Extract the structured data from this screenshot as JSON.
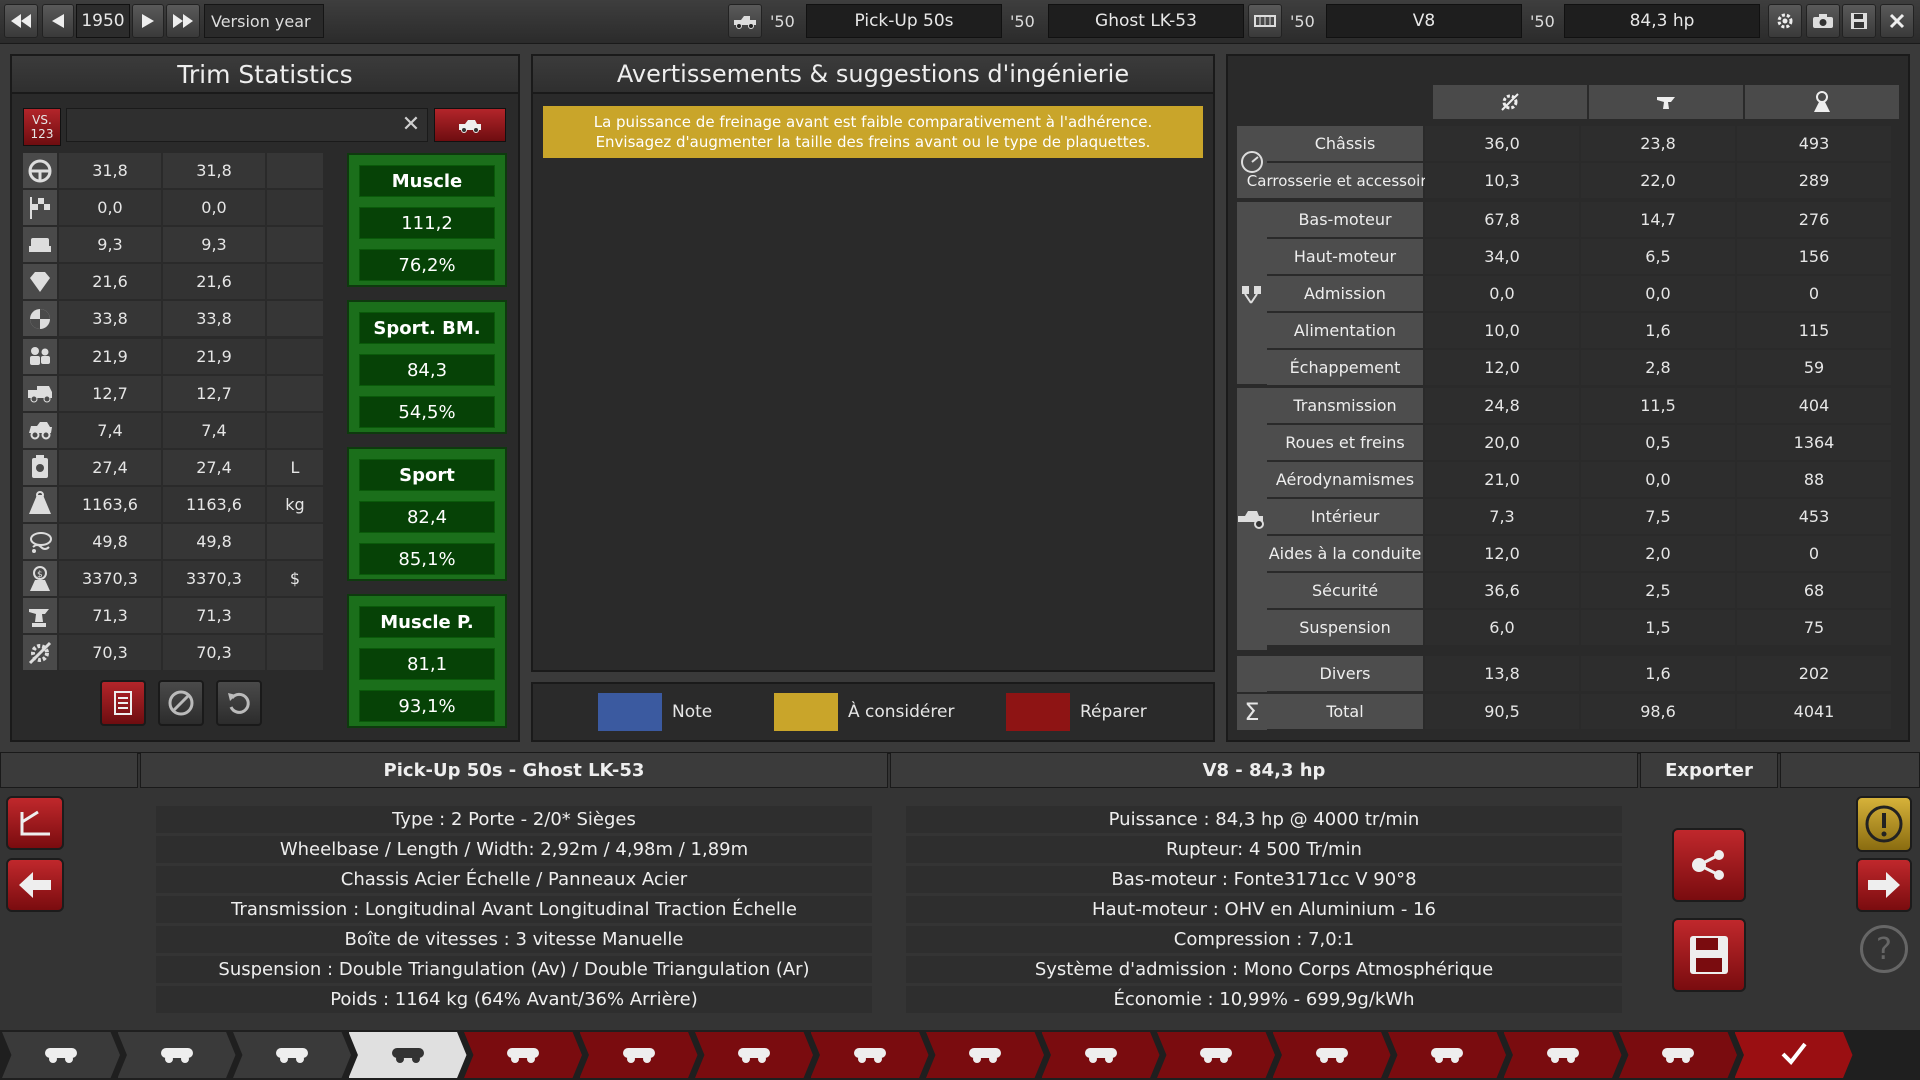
{
  "topbar": {
    "year": "1950",
    "year_label": "Version year",
    "model_year": "'50",
    "model_name": "Pick-Up 50s",
    "trim_year": "'50",
    "trim_name": "Ghost LK-53",
    "engine_year": "'50",
    "engine_name": "V8",
    "variant_year": "'50",
    "variant_name": "84,3 hp"
  },
  "trim_stats": {
    "title": "Trim Statistics",
    "vs_label": "VS.\n123",
    "search_value": "",
    "rows": [
      {
        "icon": "steering-wheel-icon",
        "a": "31,8",
        "b": "31,8",
        "unit": ""
      },
      {
        "icon": "race-flag-icon",
        "a": "0,0",
        "b": "0,0",
        "unit": ""
      },
      {
        "icon": "seat-icon",
        "a": "9,3",
        "b": "9,3",
        "unit": ""
      },
      {
        "icon": "diamond-icon",
        "a": "21,6",
        "b": "21,6",
        "unit": ""
      },
      {
        "icon": "safety-icon",
        "a": "33,8",
        "b": "33,8",
        "unit": ""
      },
      {
        "icon": "passengers-icon",
        "a": "21,9",
        "b": "21,9",
        "unit": ""
      },
      {
        "icon": "cargo-icon",
        "a": "12,7",
        "b": "12,7",
        "unit": ""
      },
      {
        "icon": "offroad-icon",
        "a": "7,4",
        "b": "7,4",
        "unit": ""
      },
      {
        "icon": "fuel-can-icon",
        "a": "27,4",
        "b": "27,4",
        "unit": "L"
      },
      {
        "icon": "weight-icon",
        "a": "1163,6",
        "b": "1163,6",
        "unit": "kg"
      },
      {
        "icon": "emissions-icon",
        "a": "49,8",
        "b": "49,8",
        "unit": ""
      },
      {
        "icon": "cost-icon",
        "a": "3370,3",
        "b": "3370,3",
        "unit": "$"
      },
      {
        "icon": "production-icon",
        "a": "71,3",
        "b": "71,3",
        "unit": ""
      },
      {
        "icon": "engineering-icon",
        "a": "70,3",
        "b": "70,3",
        "unit": ""
      }
    ],
    "markets": [
      {
        "name": "Muscle",
        "score": "111,2",
        "pct": "76,2%"
      },
      {
        "name": "Sport. BM.",
        "score": "84,3",
        "pct": "54,5%"
      },
      {
        "name": "Sport",
        "score": "82,4",
        "pct": "85,1%"
      },
      {
        "name": "Muscle P.",
        "score": "81,1",
        "pct": "93,1%"
      }
    ]
  },
  "warnings": {
    "title": "Avertissements & suggestions d'ingénierie",
    "items": [
      {
        "line1": "La puissance de freinage avant est faible comparativement à l'adhérence.",
        "line2": "Envisagez d'augmenter la taille des freins avant ou le type de plaquettes.",
        "color": "#c9a52a"
      }
    ],
    "legend": [
      {
        "label": "Note",
        "color": "#3b5aa0"
      },
      {
        "label": "À considérer",
        "color": "#c9a52a"
      },
      {
        "label": "Réparer",
        "color": "#8e1414"
      }
    ]
  },
  "cost_table": {
    "rows": [
      {
        "label": "Châssis",
        "a": "36,0",
        "b": "23,8",
        "c": "493"
      },
      {
        "label": "Carrosserie et accessoires",
        "a": "10,3",
        "b": "22,0",
        "c": "289"
      },
      {
        "label": "Bas-moteur",
        "a": "67,8",
        "b": "14,7",
        "c": "276"
      },
      {
        "label": "Haut-moteur",
        "a": "34,0",
        "b": "6,5",
        "c": "156"
      },
      {
        "label": "Admission",
        "a": "0,0",
        "b": "0,0",
        "c": "0"
      },
      {
        "label": "Alimentation",
        "a": "10,0",
        "b": "1,6",
        "c": "115"
      },
      {
        "label": "Échappement",
        "a": "12,0",
        "b": "2,8",
        "c": "59"
      },
      {
        "label": "Transmission",
        "a": "24,8",
        "b": "11,5",
        "c": "404"
      },
      {
        "label": "Roues et freins",
        "a": "20,0",
        "b": "0,5",
        "c": "1364"
      },
      {
        "label": "Aérodynamismes",
        "a": "21,0",
        "b": "0,0",
        "c": "88"
      },
      {
        "label": "Intérieur",
        "a": "7,3",
        "b": "7,5",
        "c": "453"
      },
      {
        "label": "Aides à la conduite",
        "a": "12,0",
        "b": "2,0",
        "c": "0"
      },
      {
        "label": "Sécurité",
        "a": "36,6",
        "b": "2,5",
        "c": "68"
      },
      {
        "label": "Suspension",
        "a": "6,0",
        "b": "1,5",
        "c": "75"
      },
      {
        "label": "Divers",
        "a": "13,8",
        "b": "1,6",
        "c": "202"
      },
      {
        "label": "Total",
        "a": "90,5",
        "b": "98,6",
        "c": "4041"
      }
    ]
  },
  "summary": {
    "car_title": "Pick-Up 50s - Ghost LK-53",
    "engine_title": "V8 - 84,3 hp",
    "export_label": "Exporter",
    "car_lines": [
      "Type : 2 Porte - 2/0* Sièges",
      "Wheelbase / Length / Width: 2,92m / 4,98m / 1,89m",
      "Chassis Acier Échelle / Panneaux Acier",
      "Transmission : Longitudinal Avant Longitudinal Traction Échelle",
      "Boîte de vitesses : 3 vitesse Manuelle",
      "Suspension : Double Triangulation (Av) / Double Triangulation (Ar)",
      "Poids : 1164 kg (64% Avant/36% Arrière)"
    ],
    "engine_lines": [
      "Puissance : 84,3 hp @ 4000 tr/min",
      "Rupteur: 4 500 Tr/min",
      "Bas-moteur : Fonte3171cc V 90°8",
      "Haut-moteur : OHV en Aluminium - 16",
      "Compression : 7,0:1",
      "Système d'admission : Mono Corps Atmosphérique",
      "Économie : 10,99% - 699,9g/kWh"
    ]
  },
  "nav_tabs": [
    "car-icon",
    "chassis-icon",
    "engine-icon",
    "body-icon",
    "trim-icon",
    "engine-tune-icon",
    "fuel-system-icon",
    "exhaust-icon",
    "wheels-icon",
    "brakes-icon",
    "aero-icon",
    "interior-icon",
    "driving-aids-icon",
    "suspension-icon",
    "test-track-icon",
    "finish-icon"
  ]
}
